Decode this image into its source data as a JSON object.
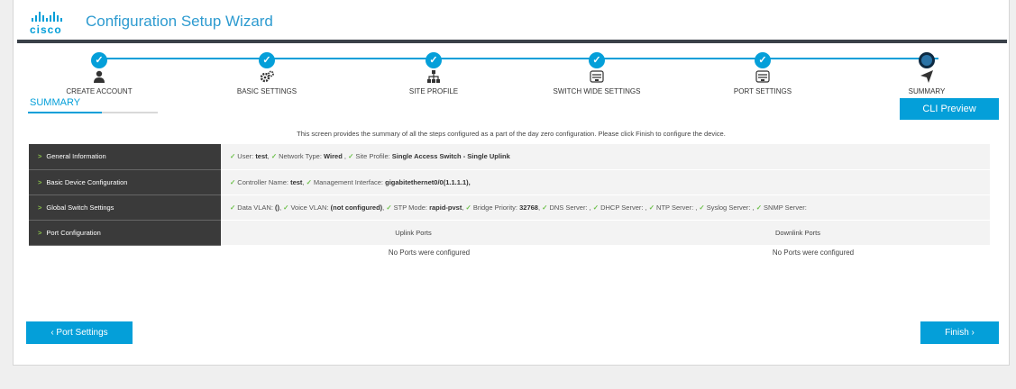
{
  "header": {
    "logo_text": "cisco",
    "title": "Configuration Setup Wizard"
  },
  "steps": [
    {
      "label": "CREATE ACCOUNT",
      "icon": "user-icon",
      "status": "done",
      "check": "✓"
    },
    {
      "label": "BASIC SETTINGS",
      "icon": "gears-icon",
      "status": "done",
      "check": "✓"
    },
    {
      "label": "SITE PROFILE",
      "icon": "hierarchy-icon",
      "status": "done",
      "check": "✓"
    },
    {
      "label": "SWITCH WIDE SETTINGS",
      "icon": "switch-icon",
      "status": "done",
      "check": "✓"
    },
    {
      "label": "PORT SETTINGS",
      "icon": "switch-icon",
      "status": "done",
      "check": "✓"
    },
    {
      "label": "SUMMARY",
      "icon": "paper-plane-icon",
      "status": "current",
      "check": ""
    }
  ],
  "summary_tab": "SUMMARY",
  "cli_preview": "CLI Preview",
  "intro": "This screen provides the summary of all the steps configured as a part of the day zero configuration. Please click Finish to configure the device.",
  "rows": {
    "general": {
      "label": "General Information",
      "items": [
        {
          "k": "User:",
          "v": "test",
          "sep": ","
        },
        {
          "k": "Network Type:",
          "v": "Wired",
          "sep": " ,"
        },
        {
          "k": "Site Profile:",
          "v": "Single Access Switch - Single Uplink",
          "sep": ""
        }
      ]
    },
    "basic": {
      "label": "Basic Device Configuration",
      "items": [
        {
          "k": "Controller Name:",
          "v": "test",
          "sep": ","
        },
        {
          "k": "Management Interface:",
          "v": "gigabitethernet0/0(1.1.1.1),",
          "sep": ""
        }
      ]
    },
    "global": {
      "label": "Global Switch Settings",
      "items": [
        {
          "k": "Data VLAN:",
          "v": "()",
          "sep": ","
        },
        {
          "k": "Voice VLAN:",
          "v": "(not configured)",
          "sep": ","
        },
        {
          "k": "STP Mode:",
          "v": "rapid-pvst",
          "sep": ","
        },
        {
          "k": "Bridge Priority:",
          "v": "32768",
          "sep": ","
        },
        {
          "k": "DNS Server:",
          "v": "",
          "sep": " ,"
        },
        {
          "k": "DHCP Server:",
          "v": "",
          "sep": " ,"
        },
        {
          "k": "NTP Server:",
          "v": "",
          "sep": " ,"
        },
        {
          "k": "Syslog Server:",
          "v": "",
          "sep": " ,"
        },
        {
          "k": "SNMP Server:",
          "v": "",
          "sep": ""
        }
      ]
    },
    "ports": {
      "label": "Port Configuration",
      "uplink_header": "Uplink Ports",
      "downlink_header": "Downlink Ports",
      "uplink_value": "No Ports were configured",
      "downlink_value": "No Ports were configured"
    }
  },
  "buttons": {
    "back": "‹ Port Settings",
    "finish": "Finish ›"
  },
  "colors": {
    "accent": "#049fd9",
    "check": "#6cc04a",
    "row_label_bg": "#3a3a3a"
  }
}
